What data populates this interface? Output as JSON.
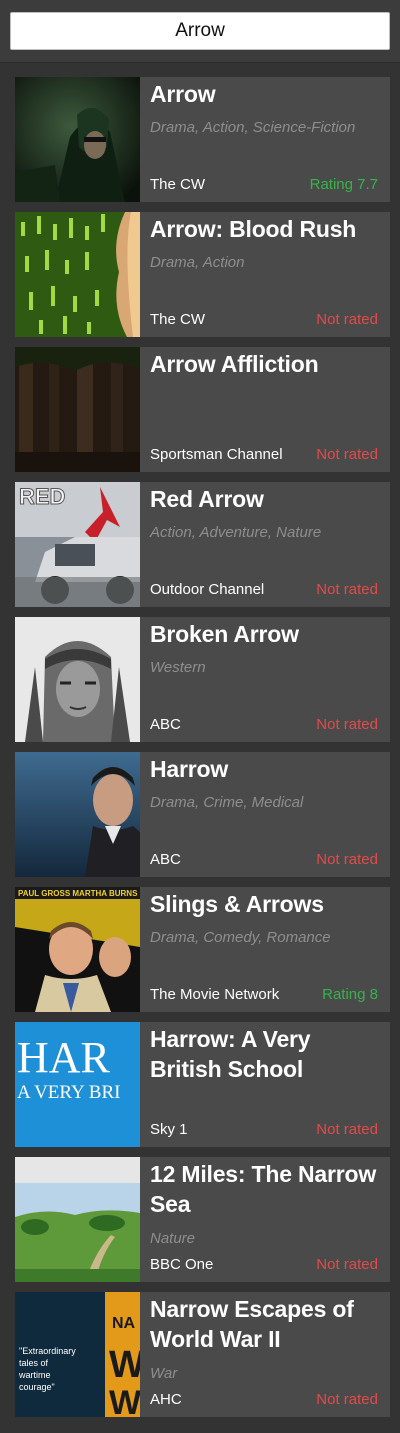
{
  "search": {
    "value": "Arrow"
  },
  "colors": {
    "rated": "#37b34a",
    "not_rated": "#e24a4a",
    "genre_text": "#8e8e8e",
    "card_bg": "#4a4a4a"
  },
  "shows": [
    {
      "title": "Arrow",
      "genres": "Drama, Action, Science-Fiction",
      "network": "The CW",
      "rating": "Rating 7.7",
      "rated": true,
      "thumb": "arrow-poster"
    },
    {
      "title": "Arrow: Blood Rush",
      "genres": "Drama, Action",
      "network": "The CW",
      "rating": "Not rated",
      "rated": false,
      "thumb": "blood-rush-poster"
    },
    {
      "title": "Arrow Affliction",
      "genres": "",
      "network": "Sportsman Channel",
      "rating": "Not rated",
      "rated": false,
      "thumb": "forest-poster"
    },
    {
      "title": "Red Arrow",
      "genres": "Action, Adventure, Nature",
      "network": "Outdoor Channel",
      "rating": "Not rated",
      "rated": false,
      "thumb": "red-arrow-poster",
      "thumb_text": "RED"
    },
    {
      "title": "Broken Arrow",
      "genres": "Western",
      "network": "ABC",
      "rating": "Not rated",
      "rated": false,
      "thumb": "broken-arrow-poster"
    },
    {
      "title": "Harrow",
      "genres": "Drama, Crime, Medical",
      "network": "ABC",
      "rating": "Not rated",
      "rated": false,
      "thumb": "harrow-poster"
    },
    {
      "title": "Slings & Arrows",
      "genres": "Drama, Comedy, Romance",
      "network": "The Movie Network",
      "rating": "Rating 8",
      "rated": true,
      "thumb": "slings-arrows-poster",
      "thumb_text": "PAUL GROSS  MARTHA BURNS"
    },
    {
      "title": "Harrow: A Very British School",
      "genres": "",
      "network": "Sky 1",
      "rating": "Not rated",
      "rated": false,
      "thumb": "harrow-school-poster",
      "thumb_text": "HAR",
      "thumb_subtext": "A VERY BRI"
    },
    {
      "title": "12 Miles: The Narrow Sea",
      "genres": "Nature",
      "network": "BBC One",
      "rating": "Not rated",
      "rated": false,
      "thumb": "narrow-sea-poster"
    },
    {
      "title": "Narrow Escapes of World War II",
      "genres": "War",
      "network": "AHC",
      "rating": "Not rated",
      "rated": false,
      "thumb": "narrow-escapes-poster",
      "thumb_text": "\"Extraordinary tales of wartime courage\""
    }
  ]
}
